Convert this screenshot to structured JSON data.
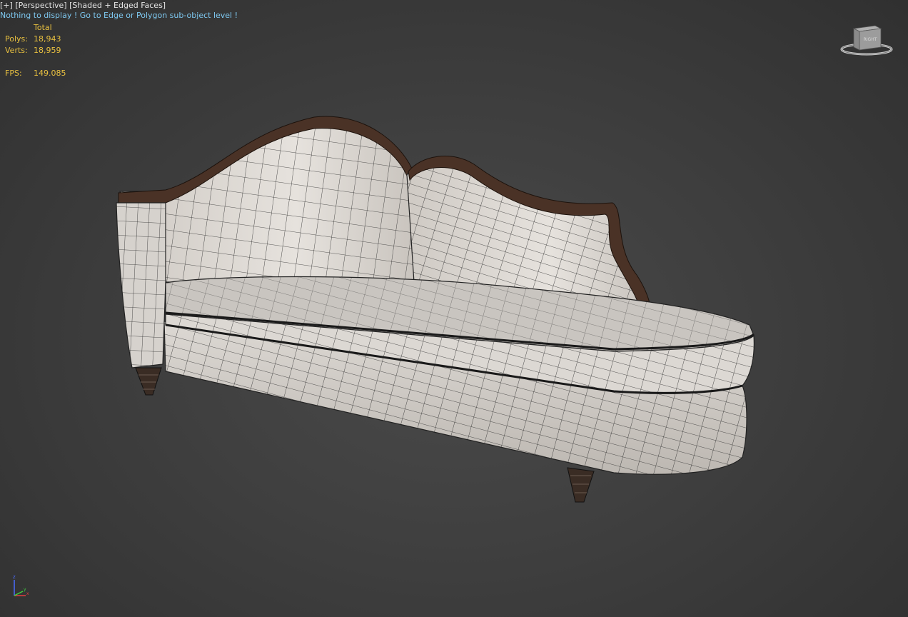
{
  "viewport": {
    "plus_label": "[+]",
    "view_label": "[Perspective]",
    "shading_label": "[Shaded + Edged Faces]",
    "message": "Nothing to display ! Go to Edge or Polygon sub-object level !"
  },
  "stats": {
    "header": "Total",
    "polys_label": "Polys:",
    "polys_value": "18,943",
    "verts_label": "Verts:",
    "verts_value": "18,959",
    "fps_label": "FPS:",
    "fps_value": "149.085"
  },
  "viewcube": {
    "face_label": "RIGHT",
    "icon": "viewcube-icon"
  },
  "axis_gizmo": {
    "z_label": "z",
    "x_label": "x",
    "y_label": "y"
  },
  "colors": {
    "background": "#404040",
    "fabric": "#d8d4cf",
    "wood_trim": "#4a3226",
    "stats_text": "#e8c040",
    "message_text": "#7ec8f0"
  },
  "model": {
    "name": "chaise-longue"
  }
}
